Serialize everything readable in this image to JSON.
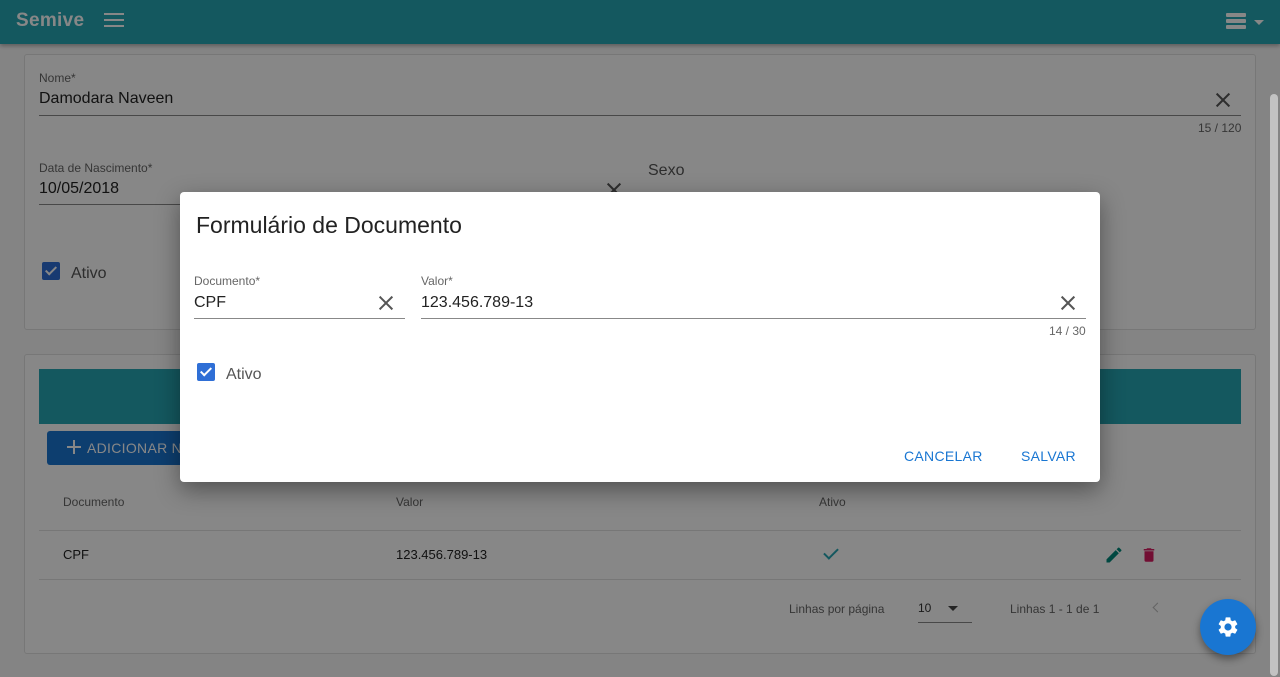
{
  "app": {
    "title": "Semive"
  },
  "person_form": {
    "nome": {
      "label": "Nome*",
      "value": "Damodara Naveen",
      "counter": "15 / 120"
    },
    "nascimento": {
      "label": "Data de Nascimento*",
      "value": "10/05/2018"
    },
    "sexo": {
      "label": "Sexo"
    },
    "ativo": {
      "label": "Ativo",
      "checked": true
    }
  },
  "documents": {
    "add_button": "ADICIONAR N",
    "columns": [
      "Documento",
      "Valor",
      "Ativo"
    ],
    "rows": [
      {
        "documento": "CPF",
        "valor": "123.456.789-13",
        "ativo": true
      }
    ],
    "pagination": {
      "rows_per_page_label": "Linhas por página",
      "rows_per_page": "10",
      "range": "Linhas 1 - 1 de 1"
    }
  },
  "dialog": {
    "title": "Formulário de Documento",
    "documento": {
      "label": "Documento*",
      "value": "CPF"
    },
    "valor": {
      "label": "Valor*",
      "value": "123.456.789-13",
      "counter": "14 / 30"
    },
    "ativo": {
      "label": "Ativo",
      "checked": true
    },
    "cancel_label": "CANCELAR",
    "save_label": "SALVAR"
  },
  "colors": {
    "primary": "#26a6b4",
    "accent": "#1976d2",
    "delete": "#d81b60",
    "edit": "#00897b"
  }
}
